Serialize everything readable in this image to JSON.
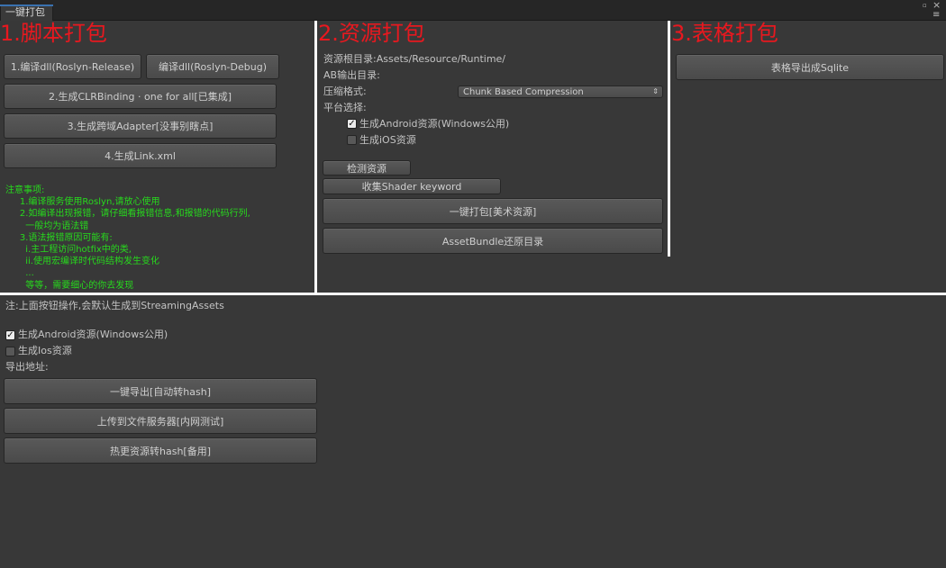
{
  "window": {
    "tab_title": "一键打包",
    "icons": [
      "minimize-icon",
      "close-icon",
      "menu-icon"
    ],
    "close_glyph": "×",
    "menu_glyph": "≡"
  },
  "colors": {
    "heading": "#e8181f",
    "notes": "#27d91d",
    "divider": "#ffffff",
    "background": "#383838"
  },
  "script_section": {
    "heading": "1.脚本打包",
    "buttons": {
      "compile_release": "1.编译dll(Roslyn-Release)",
      "compile_debug": "编译dll(Roslyn-Debug)",
      "clr_binding": "2.生成CLRBinding · one for all[已集成]",
      "adapter": "3.生成跨域Adapter[没事别瞎点]",
      "link_xml": "4.生成Link.xml"
    },
    "notes": [
      "注意事项:",
      "     1.编译服务使用Roslyn,请放心使用",
      "     2.如编译出现报错，请仔细看报错信息,和报错的代码行列,",
      "       一般均为语法错",
      "     3.语法报错原因可能有:",
      "       i.主工程访问hotfix中的类,",
      "       ii.使用宏编译时代码结构发生变化",
      "       ...",
      "       等等，需要细心的你去发现"
    ]
  },
  "asset_section": {
    "heading": "2.资源打包",
    "resource_root_label": "资源根目录:Assets/Resource/Runtime/",
    "ab_output_label": "AB输出目录:",
    "compression_label": "压缩格式:",
    "compression_value": "Chunk Based Compression",
    "platform_label": "平台选择:",
    "android_label": "生成Android资源(Windows公用)",
    "android_checked": true,
    "ios_label": "生成iOS资源",
    "ios_checked": false,
    "buttons": {
      "check_assets": "检测资源",
      "collect_shader": "收集Shader keyword",
      "one_click_art": "一键打包[美术资源]",
      "restore_dir": "AssetBundle还原目录"
    }
  },
  "table_section": {
    "heading": "3.表格打包",
    "export_sqlite": "表格导出成Sqlite"
  },
  "bottom_section": {
    "note": "注:上面按钮操作,会默认生成到StreamingAssets",
    "android_label": "生成Android资源(Windows公用)",
    "android_checked": true,
    "ios_label": "生成Ios资源",
    "ios_checked": false,
    "export_path_label": "导出地址:",
    "buttons": {
      "one_click_export": "一键导出[自动转hash]",
      "upload_server": "上传到文件服务器[内网测试]",
      "hotfix_hash": "热更资源转hash[备用]"
    }
  }
}
